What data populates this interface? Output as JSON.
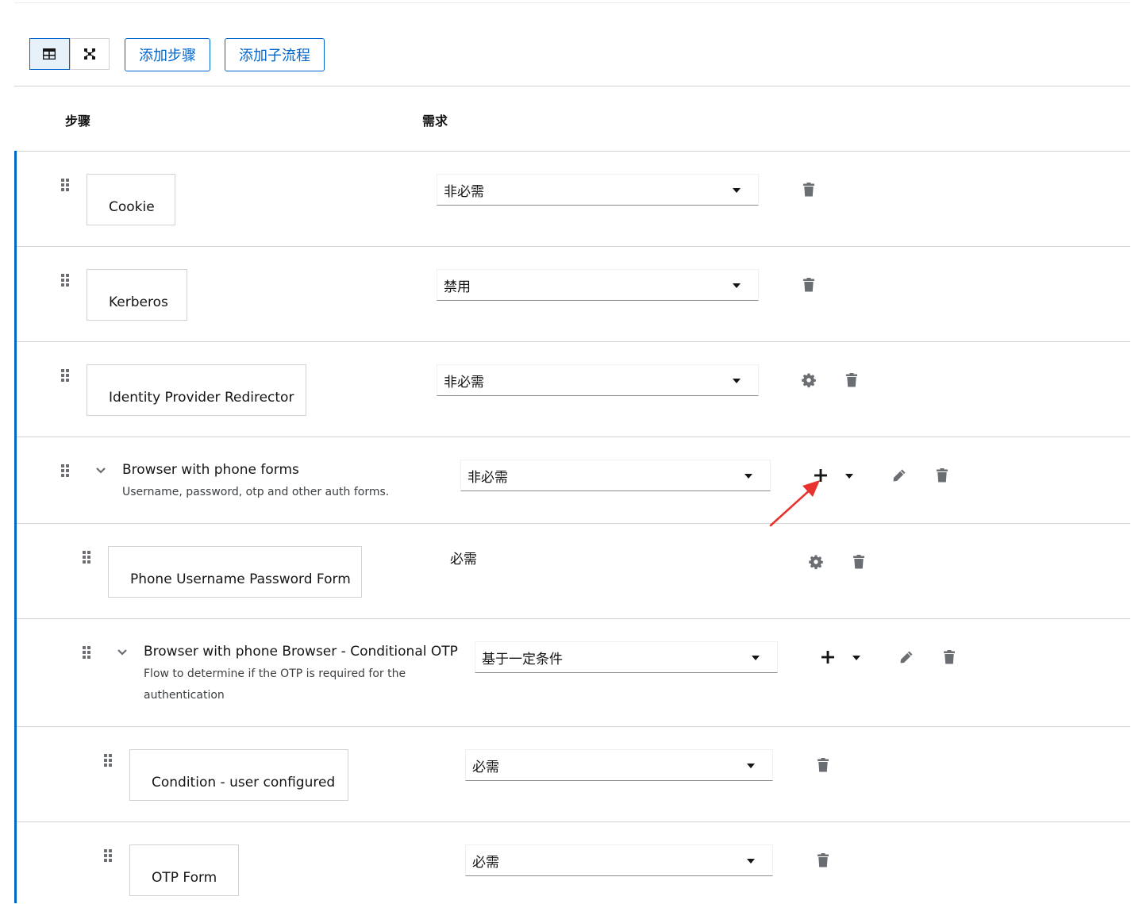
{
  "toolbar": {
    "add_step_label": "添加步骤",
    "add_subflow_label": "添加子流程"
  },
  "table": {
    "col_step": "步骤",
    "col_requirement": "需求"
  },
  "rows": [
    {
      "name": "Cookie",
      "requirement": "非必需"
    },
    {
      "name": "Kerberos",
      "requirement": "禁用"
    },
    {
      "name": "Identity Provider Redirector",
      "requirement": "非必需"
    },
    {
      "name": "Browser with phone forms",
      "description": "Username, password, otp and other auth forms.",
      "requirement": "非必需"
    },
    {
      "name": "Phone Username Password Form",
      "requirement": "必需"
    },
    {
      "name": "Browser with phone Browser - Conditional OTP",
      "description": "Flow to determine if the OTP is required for the authentication",
      "requirement": "基于一定条件"
    },
    {
      "name": "Condition - user configured",
      "requirement": "必需"
    },
    {
      "name": "OTP Form",
      "requirement": "必需"
    }
  ],
  "colors": {
    "primary": "#0066cc",
    "annotation_arrow": "#e8322d",
    "icon_gray": "#6a6e73"
  }
}
